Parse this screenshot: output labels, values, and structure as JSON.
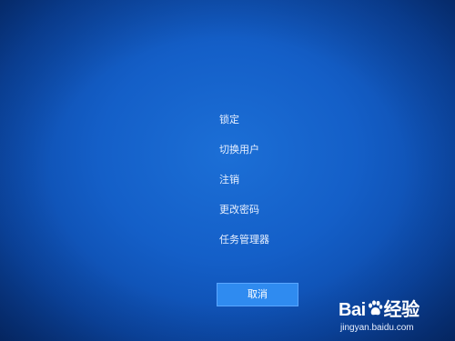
{
  "menu": {
    "items": [
      {
        "label": "锁定"
      },
      {
        "label": "切换用户"
      },
      {
        "label": "注销"
      },
      {
        "label": "更改密码"
      },
      {
        "label": "任务管理器"
      }
    ]
  },
  "cancel_label": "取消",
  "watermark": {
    "brand_left": "Bai",
    "brand_right": "经验",
    "url": "jingyan.baidu.com"
  },
  "colors": {
    "background": "#145fc8",
    "button": "#2f8bf0"
  }
}
